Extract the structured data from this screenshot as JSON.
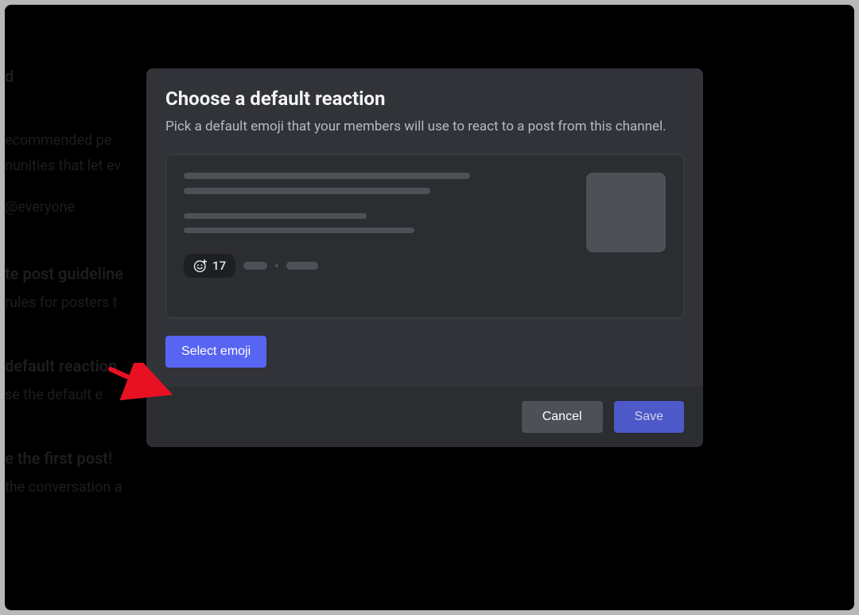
{
  "background": {
    "line1": "d",
    "line2": "ecommended pe",
    "line3": "nunities that let ev",
    "line4": "@everyone",
    "line5": "te post guideline",
    "line6": "rules for posters t",
    "line7": "default reaction",
    "line8": "se the default e",
    "line9": "e the first post!",
    "line10": "the conversation a"
  },
  "modal": {
    "title": "Choose a default reaction",
    "description": "Pick a default emoji that your members will use to react to a post from this channel.",
    "reaction_count": "17",
    "select_emoji_label": "Select emoji",
    "cancel_label": "Cancel",
    "save_label": "Save"
  }
}
